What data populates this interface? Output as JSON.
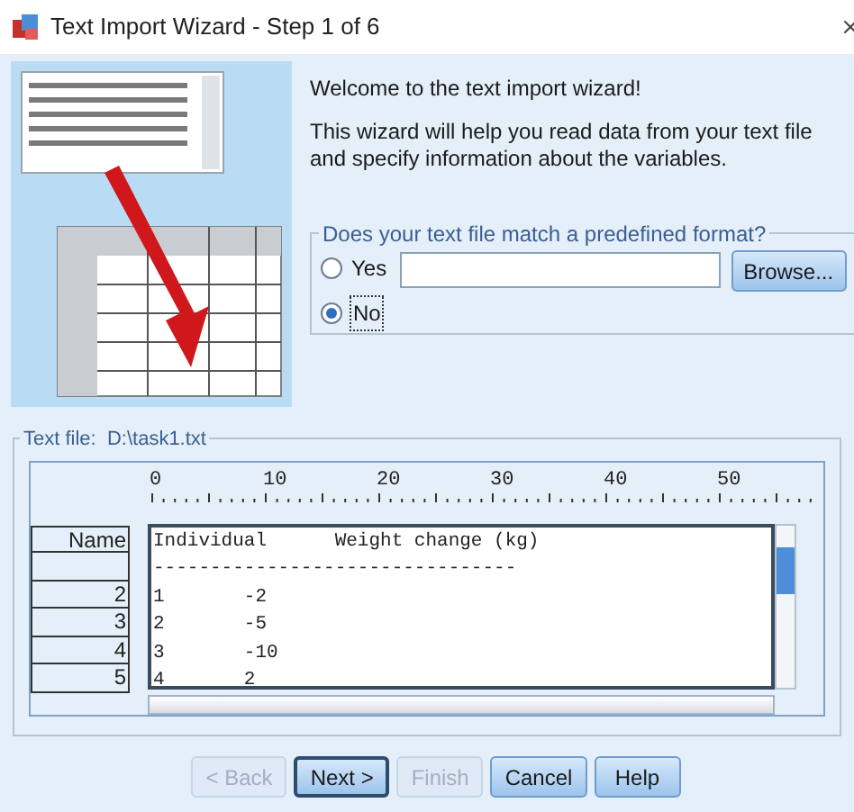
{
  "window": {
    "title": "Text Import Wizard - Step 1 of 6"
  },
  "intro": {
    "heading": "Welcome to the text import wizard!",
    "body": "This wizard will help you read data from your text file and specify information about the variables."
  },
  "format_group": {
    "legend": "Does your text file match a predefined format?",
    "options": [
      {
        "label": "Yes",
        "selected": false
      },
      {
        "label": "No",
        "selected": true
      }
    ],
    "browse_button": "Browse..."
  },
  "text_file": {
    "legend": "Text file:  D:\\task1.txt",
    "ruler": [
      "0",
      "10",
      "20",
      "30",
      "40",
      "50"
    ],
    "rows": [
      {
        "label": "Name",
        "text": "Individual      Weight change (kg)"
      },
      {
        "label": "",
        "text": "--------------------------------"
      },
      {
        "label": "2",
        "text": "1       -2"
      },
      {
        "label": "3",
        "text": "2       -5"
      },
      {
        "label": "4",
        "text": "3       -10"
      },
      {
        "label": "5",
        "text": "4       2"
      }
    ]
  },
  "buttons": [
    {
      "label": "< Back",
      "disabled": true,
      "default": false
    },
    {
      "label": "Next >",
      "disabled": false,
      "default": true
    },
    {
      "label": "Finish",
      "disabled": true,
      "default": false
    },
    {
      "label": "Cancel",
      "disabled": false,
      "default": false
    },
    {
      "label": "Help",
      "disabled": false,
      "default": false
    }
  ]
}
